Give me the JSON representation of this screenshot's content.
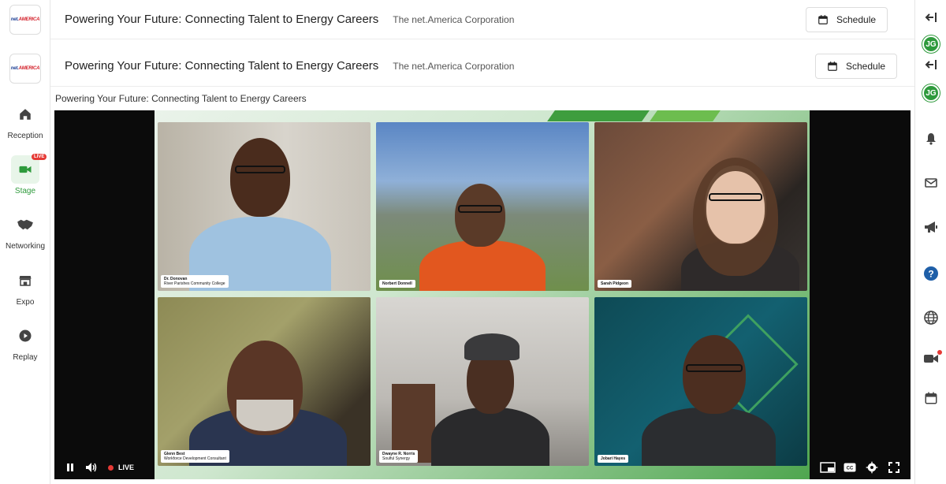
{
  "sidebar": {
    "logo_text_a": "net.",
    "logo_text_b": "AMERICA",
    "items": [
      {
        "label": "Reception",
        "icon": "home-icon"
      },
      {
        "label": "Stage",
        "icon": "video-camera-icon",
        "badge": "LIVE",
        "active": true
      },
      {
        "label": "Networking",
        "icon": "handshake-icon"
      },
      {
        "label": "Expo",
        "icon": "storefront-icon"
      },
      {
        "label": "Replay",
        "icon": "play-circle-icon"
      }
    ]
  },
  "header_top": {
    "title": "Powering Your Future: Connecting Talent to Energy Careers",
    "org": "The net.America Corporation",
    "schedule_label": "Schedule"
  },
  "header": {
    "title": "Powering Your Future: Connecting Talent to Energy Careers",
    "org": "The net.America Corporation",
    "schedule_label": "Schedule"
  },
  "video": {
    "caption": "Powering Your Future: Connecting Talent to Energy Careers",
    "participants": [
      {
        "name": "Dr. Donovan",
        "sub": "River Parishes Community College"
      },
      {
        "name": "Norbert Donnell",
        "sub": ""
      },
      {
        "name": "Sarah Pidgeon",
        "sub": ""
      },
      {
        "name": "Glenn Best",
        "sub": "Workforce Development Consultant"
      },
      {
        "name": "Dwayne R. Norris",
        "sub": "Soulful Synergy"
      },
      {
        "name": "Jobari Hayes",
        "sub": ""
      }
    ],
    "controls": {
      "live_label": "LIVE"
    }
  },
  "right_rail": {
    "avatar_initials_top": "JG",
    "avatar_initials": "JG"
  },
  "colors": {
    "accent": "#2e9a3c",
    "live": "#e53935",
    "brand_blue": "#1c3f94"
  }
}
